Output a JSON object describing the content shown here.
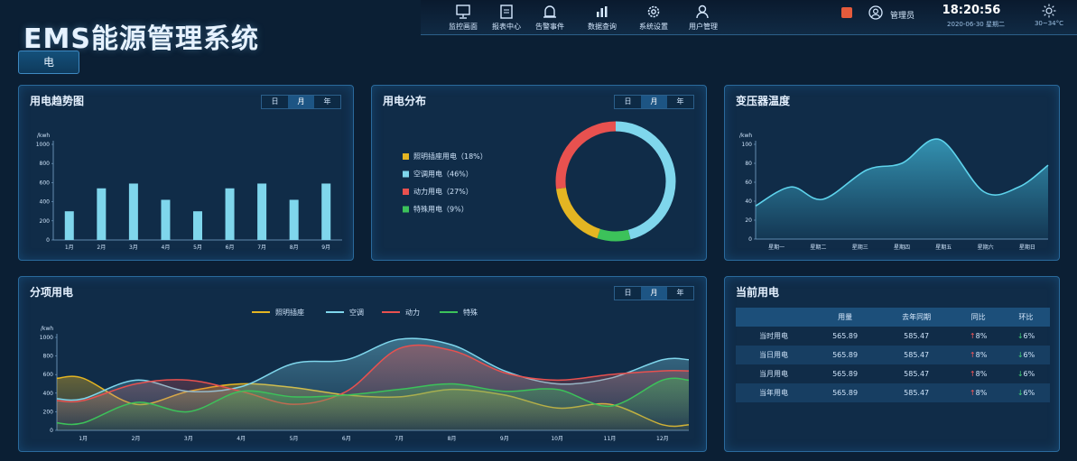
{
  "app": {
    "title": "EMS能源管理系统"
  },
  "nav": [
    {
      "label": "监控画面",
      "icon": "monitor-icon"
    },
    {
      "label": "报表中心",
      "icon": "report-icon"
    },
    {
      "label": "告警事件",
      "icon": "alarm-event-icon"
    },
    {
      "label": "数据查询",
      "icon": "data-query-icon"
    },
    {
      "label": "系统设置",
      "icon": "settings-gear-icon"
    },
    {
      "label": "用户管理",
      "icon": "user-manage-icon"
    }
  ],
  "status": {
    "user": "管理员",
    "time": "18:20:56",
    "date": "2020-06-30 星期二",
    "temp": "30~34°C",
    "alarm_color": "#e55b3c"
  },
  "energy_tab": "电",
  "range_options": [
    "日",
    "月",
    "年"
  ],
  "range_selected": "月",
  "panels": {
    "trend": {
      "title": "用电趋势图"
    },
    "distribution": {
      "title": "用电分布"
    },
    "transformer": {
      "title": "变压器温度"
    },
    "itemized": {
      "title": "分项用电"
    },
    "current": {
      "title": "当前用电"
    }
  },
  "chart_data": [
    {
      "id": "trend",
      "type": "bar",
      "ylabel": "/kwh",
      "ylim": [
        0,
        1000
      ],
      "yticks": [
        0,
        200,
        400,
        600,
        800,
        1000
      ],
      "categories": [
        "1月",
        "2月",
        "3月",
        "4月",
        "5月",
        "6月",
        "7月",
        "8月",
        "9月"
      ],
      "values": [
        300,
        540,
        590,
        420,
        300,
        540,
        590,
        420,
        590
      ],
      "color": "#7fd6ec"
    },
    {
      "id": "distribution",
      "type": "pie",
      "legend_position": "left",
      "slices": [
        {
          "label": "照明插座用电（18%）",
          "value": 18,
          "color": "#e4b522"
        },
        {
          "label": "空调用电（46%）",
          "value": 46,
          "color": "#7fd6ec"
        },
        {
          "label": "动力用电（27%）",
          "value": 27,
          "color": "#e8514f"
        },
        {
          "label": "特殊用电（9%）",
          "value": 9,
          "color": "#3cc25a"
        }
      ]
    },
    {
      "id": "transformer",
      "type": "area",
      "ylabel": "/kwh",
      "ylim": [
        0,
        100
      ],
      "yticks": [
        0,
        20,
        40,
        60,
        80,
        100
      ],
      "categories": [
        "星期一",
        "星期二",
        "星期三",
        "星期四",
        "星期五",
        "星期六",
        "星期日"
      ],
      "values": [
        35,
        55,
        42,
        73,
        80,
        105,
        50,
        55,
        78
      ],
      "x_positions": [
        0,
        0.12,
        0.23,
        0.38,
        0.5,
        0.63,
        0.78,
        0.9,
        1.0
      ],
      "color": "#5ed3ec"
    },
    {
      "id": "itemized",
      "type": "area",
      "ylabel": "/kwh",
      "ylim": [
        0,
        1000
      ],
      "yticks": [
        0,
        200,
        400,
        600,
        800,
        1000
      ],
      "categories": [
        "1月",
        "2月",
        "3月",
        "4月",
        "5月",
        "6月",
        "7月",
        "8月",
        "9月",
        "10月",
        "11月",
        "12月"
      ],
      "legend_position": "top",
      "series": [
        {
          "name": "照明插座",
          "color": "#e4b522",
          "values": [
            560,
            280,
            420,
            500,
            460,
            380,
            360,
            440,
            380,
            240,
            280,
            60
          ]
        },
        {
          "name": "空调",
          "color": "#7fd6ec",
          "values": [
            340,
            540,
            420,
            470,
            720,
            760,
            980,
            920,
            640,
            500,
            560,
            760
          ]
        },
        {
          "name": "动力",
          "color": "#e8514f",
          "values": [
            320,
            500,
            540,
            420,
            280,
            420,
            880,
            860,
            620,
            540,
            600,
            640
          ]
        },
        {
          "name": "特殊",
          "color": "#3cc25a",
          "values": [
            80,
            300,
            200,
            420,
            360,
            380,
            440,
            500,
            420,
            440,
            260,
            540
          ]
        }
      ]
    }
  ],
  "current_table": {
    "headers": [
      "",
      "用量",
      "去年同期",
      "同比",
      "环比"
    ],
    "rows": [
      {
        "label": "当时用电",
        "usage": "565.89",
        "last_year": "585.47",
        "yoy": "8%",
        "mom": "6%"
      },
      {
        "label": "当日用电",
        "usage": "565.89",
        "last_year": "585.47",
        "yoy": "8%",
        "mom": "6%"
      },
      {
        "label": "当月用电",
        "usage": "565.89",
        "last_year": "585.47",
        "yoy": "8%",
        "mom": "6%"
      },
      {
        "label": "当年用电",
        "usage": "565.89",
        "last_year": "585.47",
        "yoy": "8%",
        "mom": "6%"
      }
    ]
  }
}
